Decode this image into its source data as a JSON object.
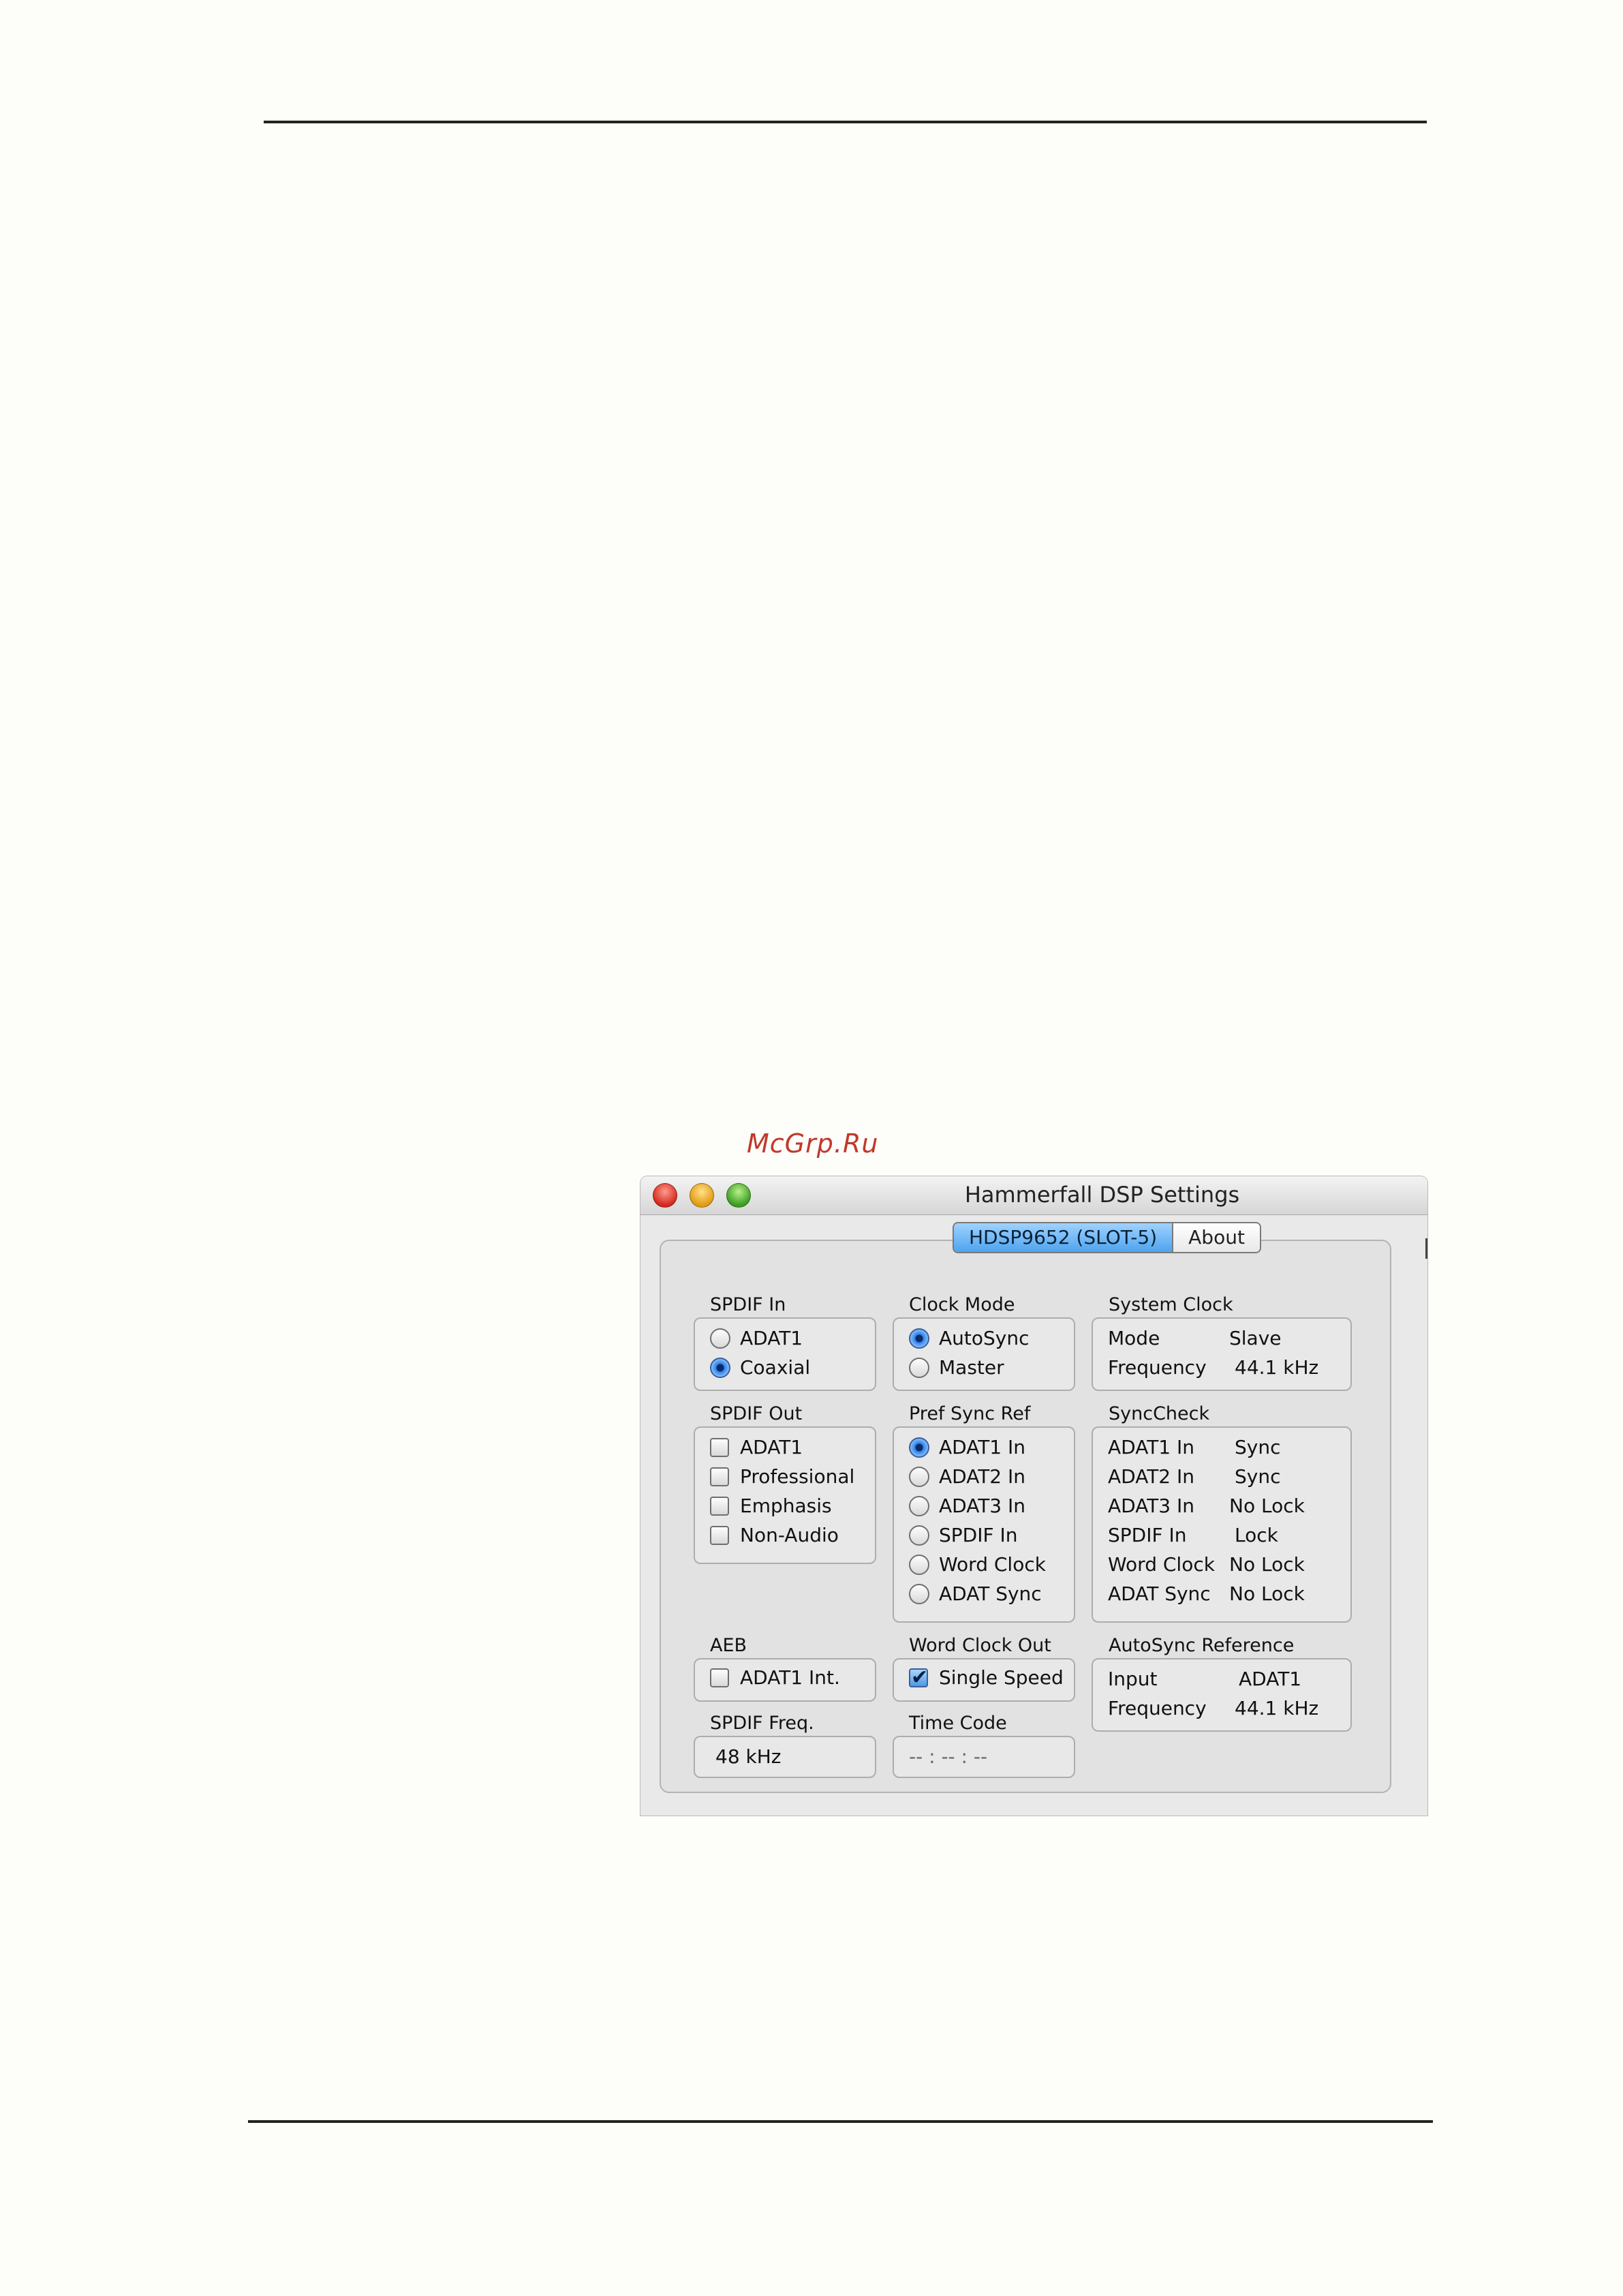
{
  "watermark": "McGrp.Ru",
  "window": {
    "title": "Hammerfall DSP Settings",
    "tabs": [
      {
        "label": "HDSP9652 (SLOT-5)",
        "active": true
      },
      {
        "label": "About",
        "active": false
      }
    ]
  },
  "groups": {
    "spdif_in": {
      "title": "SPDIF In",
      "options": [
        {
          "label": "ADAT1",
          "selected": false
        },
        {
          "label": "Coaxial",
          "selected": true
        }
      ]
    },
    "clock_mode": {
      "title": "Clock Mode",
      "options": [
        {
          "label": "AutoSync",
          "selected": true
        },
        {
          "label": "Master",
          "selected": false
        }
      ]
    },
    "system_clock": {
      "title": "System Clock",
      "rows": [
        {
          "key": "Mode",
          "value": "Slave"
        },
        {
          "key": "Frequency",
          "value": "44.1 kHz"
        }
      ]
    },
    "spdif_out": {
      "title": "SPDIF Out",
      "options": [
        {
          "label": "ADAT1",
          "checked": false
        },
        {
          "label": "Professional",
          "checked": false
        },
        {
          "label": "Emphasis",
          "checked": false
        },
        {
          "label": "Non-Audio",
          "checked": false
        }
      ]
    },
    "pref_sync_ref": {
      "title": "Pref Sync Ref",
      "options": [
        {
          "label": "ADAT1 In",
          "selected": true
        },
        {
          "label": "ADAT2 In",
          "selected": false
        },
        {
          "label": "ADAT3 In",
          "selected": false
        },
        {
          "label": "SPDIF In",
          "selected": false
        },
        {
          "label": "Word Clock",
          "selected": false
        },
        {
          "label": "ADAT Sync",
          "selected": false
        }
      ]
    },
    "sync_check": {
      "title": "SyncCheck",
      "rows": [
        {
          "key": "ADAT1 In",
          "value": "Sync"
        },
        {
          "key": "ADAT2 In",
          "value": "Sync"
        },
        {
          "key": "ADAT3 In",
          "value": "No Lock"
        },
        {
          "key": "SPDIF In",
          "value": "Lock"
        },
        {
          "key": "Word Clock",
          "value": "No Lock"
        },
        {
          "key": "ADAT Sync",
          "value": "No Lock"
        }
      ]
    },
    "aeb": {
      "title": "AEB",
      "options": [
        {
          "label": "ADAT1 Int.",
          "checked": false
        }
      ]
    },
    "word_clock_out": {
      "title": "Word Clock Out",
      "options": [
        {
          "label": "Single Speed",
          "checked": true
        }
      ]
    },
    "autosync_reference": {
      "title": "AutoSync Reference",
      "rows": [
        {
          "key": "Input",
          "value": "ADAT1"
        },
        {
          "key": "Frequency",
          "value": "44.1 kHz"
        }
      ]
    },
    "spdif_freq": {
      "title": "SPDIF Freq.",
      "value": "48 kHz"
    },
    "time_code": {
      "title": "Time Code",
      "value": "-- : -- : --"
    }
  }
}
